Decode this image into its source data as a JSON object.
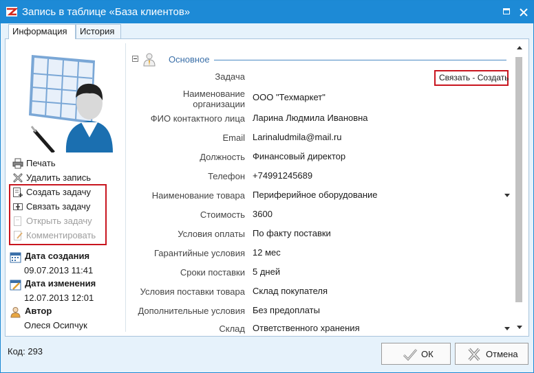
{
  "window": {
    "title": "Запись в таблице «База клиентов»",
    "accent_color": "#1d8ad6",
    "icons": [
      "app-logo-icon",
      "maximize-icon",
      "close-icon"
    ]
  },
  "tabs": [
    {
      "label": "Информация",
      "active": true
    },
    {
      "label": "История",
      "active": false
    }
  ],
  "sidebar": {
    "actions": [
      {
        "label": "Печать",
        "icon": "printer-icon",
        "enabled": true
      },
      {
        "label": "Удалить запись",
        "icon": "delete-icon",
        "enabled": true
      },
      {
        "label": "Создать задачу",
        "icon": "create-task-icon",
        "enabled": true
      },
      {
        "label": "Связать задачу",
        "icon": "link-task-icon",
        "enabled": true
      },
      {
        "label": "Открыть задачу",
        "icon": "open-task-icon",
        "enabled": false
      },
      {
        "label": "Комментировать",
        "icon": "comment-icon",
        "enabled": false
      }
    ],
    "created_label": "Дата создания",
    "created_value": "09.07.2013 11:41",
    "modified_label": "Дата изменения",
    "modified_value": "12.07.2013 12:01",
    "author_label": "Автор",
    "author_value": "Олеся Осипчук",
    "highlight_color": "#c8141e"
  },
  "group": {
    "title": "Основное"
  },
  "task_links": {
    "link_label": "Связать",
    "separator": "-",
    "create_label": "Создать"
  },
  "fields": [
    {
      "label": "Задача",
      "value": ""
    },
    {
      "label": "Наименование организации",
      "value": "ООО \"Техмаркет\""
    },
    {
      "label": "ФИО контактного лица",
      "value": "Ларина Людмила Ивановна"
    },
    {
      "label": "Email",
      "value": "Larinaludmila@mail.ru"
    },
    {
      "label": "Должность",
      "value": "Финансовый директор"
    },
    {
      "label": "Телефон",
      "value": "+74991245689"
    },
    {
      "label": "Наименование товара",
      "value": "Периферийное оборудование",
      "dropdown": true
    },
    {
      "label": "Стоимость",
      "value": "3600"
    },
    {
      "label": "Условия оплаты",
      "value": "По факту поставки"
    },
    {
      "label": "Гарантийные условия",
      "value": "12 мес"
    },
    {
      "label": "Сроки поставки",
      "value": "5 дней"
    },
    {
      "label": "Условия поставки товара",
      "value": "Склад покупателя"
    },
    {
      "label": "Дополнительные условия",
      "value": "Без предоплаты"
    },
    {
      "label": "Склад",
      "value": "Ответственного хранения",
      "dropdown": true
    }
  ],
  "footer": {
    "code_label": "Код:",
    "code_value": "293",
    "ok_label": "ОК",
    "cancel_label": "Отмена"
  }
}
